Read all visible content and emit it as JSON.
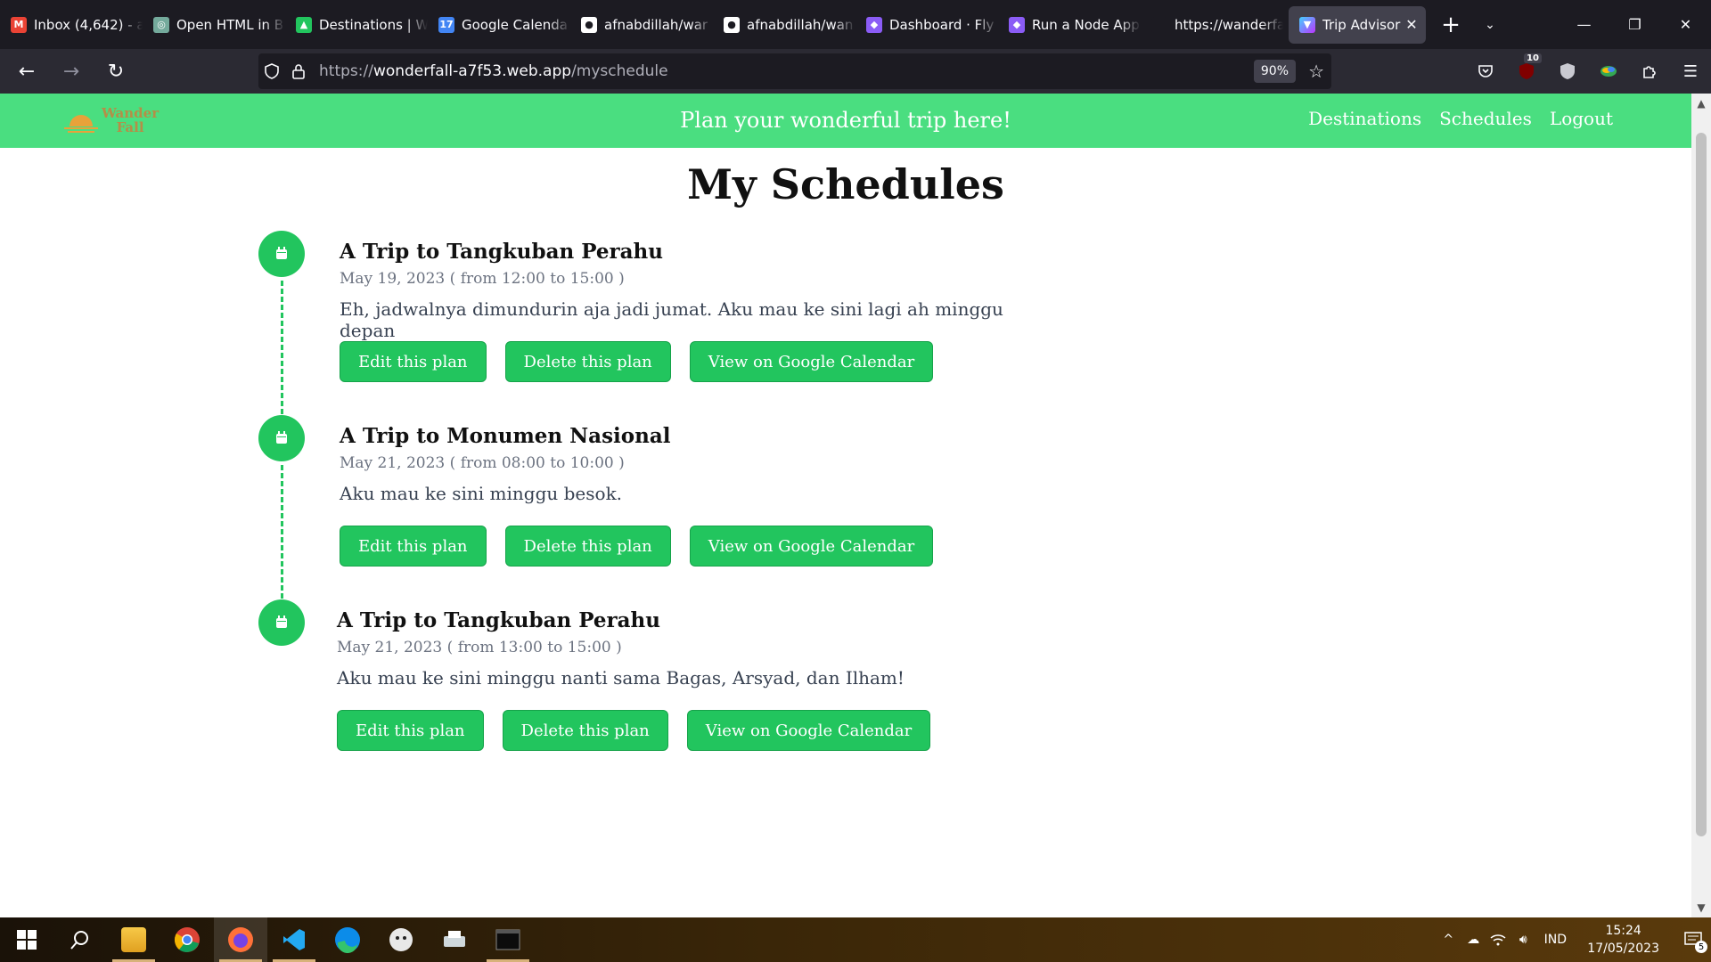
{
  "browser": {
    "tabs": [
      {
        "title": "Inbox (4,642) - a",
        "icon": "gmail-icon",
        "color": "#ea4335",
        "glyph": "M"
      },
      {
        "title": "Open HTML in B",
        "icon": "chatgpt-icon",
        "color": "#74aa9c",
        "glyph": "◎"
      },
      {
        "title": "Destinations | W",
        "icon": "app-icon",
        "color": "#22c55e",
        "glyph": "▲"
      },
      {
        "title": "Google Calenda",
        "icon": "calendar-icon",
        "color": "#4285f4",
        "glyph": "17"
      },
      {
        "title": "afnabdillah/war",
        "icon": "github-icon",
        "color": "#ffffff",
        "glyph": "●"
      },
      {
        "title": "afnabdillah/wan",
        "icon": "github-icon",
        "color": "#ffffff",
        "glyph": "●"
      },
      {
        "title": "Dashboard · Fly",
        "icon": "fly-icon",
        "color": "#8b5cf6",
        "glyph": "◆"
      },
      {
        "title": "Run a Node App",
        "icon": "fly-icon",
        "color": "#8b5cf6",
        "glyph": "◆"
      },
      {
        "title": "https://wanderfall.fl",
        "icon": "blank-icon",
        "color": "#1c1b22",
        "glyph": ""
      }
    ],
    "active_tab": {
      "title": "Trip Advisor",
      "icon": "vite-icon",
      "close": "✕"
    },
    "new_tab": "+",
    "list_tabs": "⌄",
    "window_controls": {
      "minimize": "—",
      "restore": "❐",
      "close": "✕"
    },
    "nav": {
      "back": "←",
      "forward": "→",
      "reload": "↻"
    },
    "url": {
      "proto": "https://",
      "host": "wonderfall-a7f53.web.app",
      "path": "/myschedule"
    },
    "zoom": "90%",
    "ublock_badge": "10"
  },
  "app": {
    "logo_line1": "Wander",
    "logo_line2": "Fall",
    "tagline": "Plan your wonderful trip here!",
    "nav": [
      "Destinations",
      "Schedules",
      "Logout"
    ],
    "page_title": "My Schedules",
    "accent": "#22c55e",
    "header_bg": "#4ade80",
    "buttons": {
      "edit": "Edit this plan",
      "delete": "Delete this plan",
      "view": "View on Google Calendar"
    },
    "schedules": [
      {
        "title": "A Trip to Tangkuban Perahu",
        "date": "May 19, 2023 ( from 12:00 to 15:00 )",
        "description": "Eh, jadwalnya dimundurin aja jadi jumat. Aku mau ke sini lagi ah minggu depan"
      },
      {
        "title": "A Trip to Monumen Nasional",
        "date": "May 21, 2023 ( from 08:00 to 10:00 )",
        "description": "Aku mau ke sini minggu besok."
      },
      {
        "title": "A Trip to Tangkuban Perahu",
        "date": "May 21, 2023 ( from 13:00 to 15:00 )",
        "description": "Aku mau ke sini minggu nanti sama Bagas, Arsyad, dan Ilham!"
      }
    ]
  },
  "taskbar": {
    "apps": [
      "start-icon",
      "search-icon",
      "file-explorer-icon",
      "chrome-icon",
      "firefox-icon",
      "vscode-icon",
      "edge-icon",
      "game-icon",
      "printer-icon",
      "terminal-icon"
    ],
    "language": "IND",
    "time": "15:24",
    "date": "17/05/2023",
    "notification_count": "5"
  }
}
